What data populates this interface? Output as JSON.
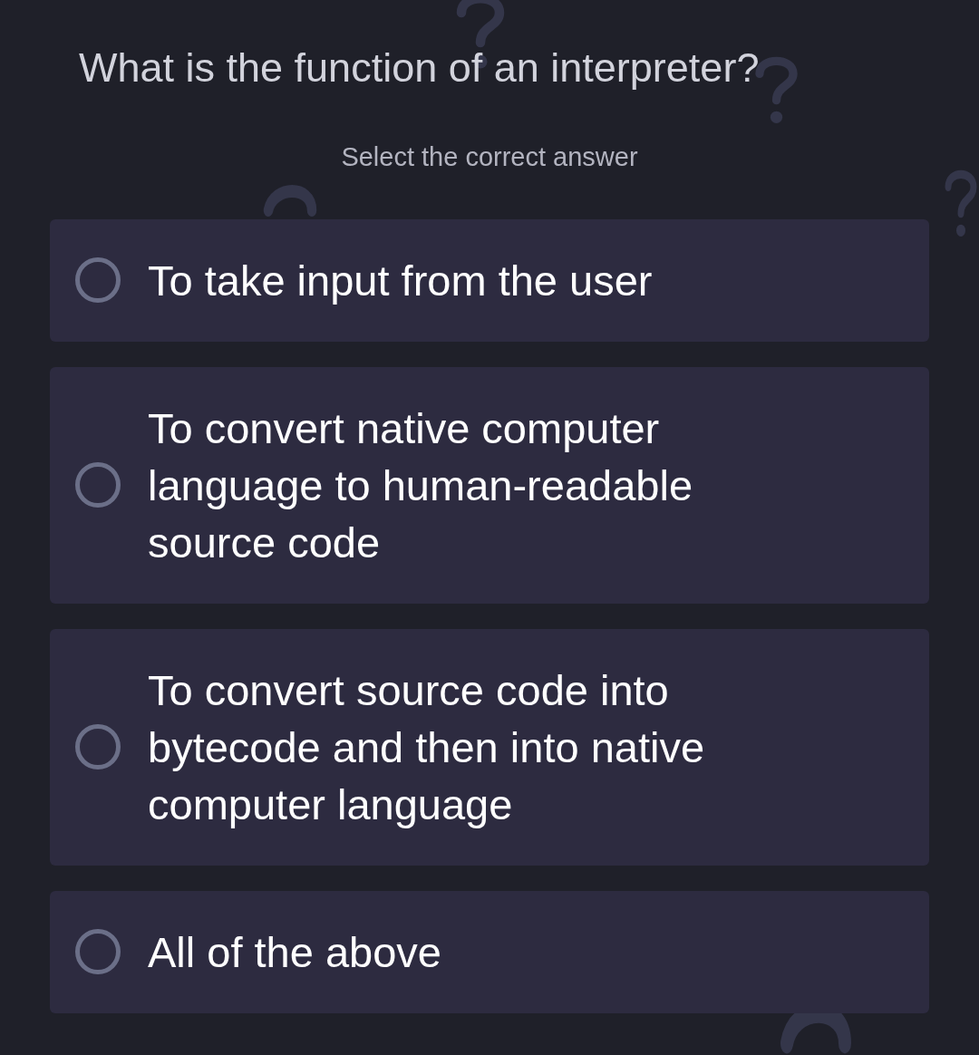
{
  "question": "What is the function of an interpreter?",
  "instruction": "Select the correct answer",
  "options": [
    {
      "text": "To take input from the user",
      "selected": false
    },
    {
      "text": "To convert native computer language to human-readable source code",
      "selected": false
    },
    {
      "text": "To convert source code into bytecode and then into native computer language",
      "selected": false
    },
    {
      "text": "All of the above",
      "selected": false
    }
  ]
}
